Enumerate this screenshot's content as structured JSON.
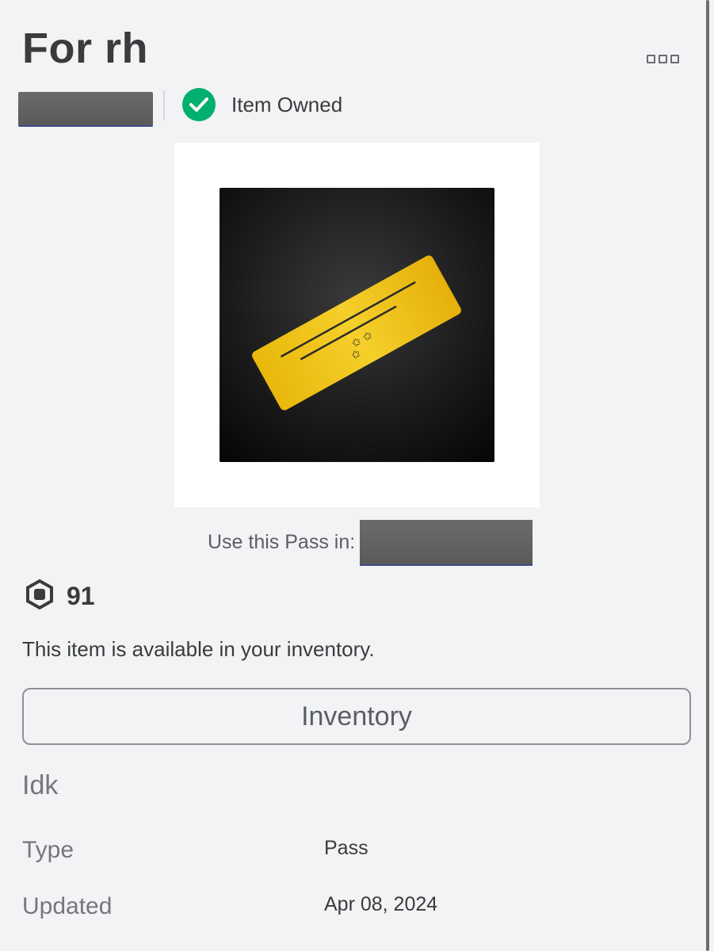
{
  "header": {
    "title": "For rh",
    "more_icon": "more-options-icon"
  },
  "ownership": {
    "status_label": "Item Owned",
    "status_icon": "checkmark-circle-icon",
    "status_color": "#00b06f"
  },
  "thumbnail": {
    "image": "gold-ticket-pass-image",
    "ticket_color": "#f2c40f",
    "background_color": "#1c1c1c"
  },
  "usage": {
    "label": "Use this Pass in:"
  },
  "price": {
    "icon": "robux-icon",
    "value": "91"
  },
  "availability": {
    "text": "This item is available in your inventory."
  },
  "actions": {
    "inventory_label": "Inventory"
  },
  "description": "Idk",
  "details": [
    {
      "label": "Type",
      "value": "Pass"
    },
    {
      "label": "Updated",
      "value": "Apr 08, 2024"
    }
  ],
  "colors": {
    "page_background": "#f2f3f5",
    "text_primary": "#393b3d",
    "text_secondary": "#75777a"
  }
}
